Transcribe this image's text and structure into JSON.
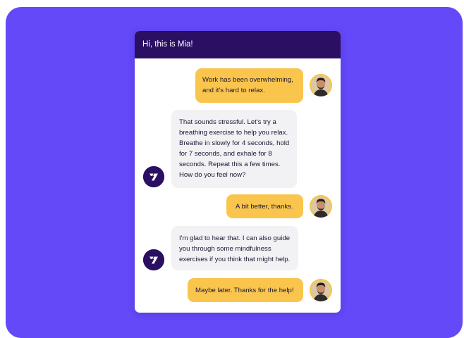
{
  "header": {
    "title": "Hi, this is Mia!"
  },
  "messages": [
    {
      "sender": "user",
      "lines": [
        "Work has been overwhelming,",
        "and it's hard to relax."
      ]
    },
    {
      "sender": "bot",
      "lines": [
        "That sounds stressful. Let's try a",
        "breathing exercise to help you relax.",
        "Breathe in slowly for 4 seconds, hold",
        "for 7 seconds, and exhale for 8",
        "seconds. Repeat this a few times.",
        "How do you feel now?"
      ]
    },
    {
      "sender": "user",
      "lines": [
        "A bit better, thanks."
      ]
    },
    {
      "sender": "bot",
      "lines": [
        "I'm glad to hear that. I can also guide",
        "you through some mindfulness",
        "exercises if you think that might help."
      ]
    },
    {
      "sender": "user",
      "lines": [
        "Maybe later. Thanks for the help!"
      ]
    }
  ],
  "colors": {
    "background": "#6349f7",
    "header": "#2b0f63",
    "user_bubble": "#fac54d",
    "bot_bubble": "#f2f1f4"
  },
  "icons": {
    "user_avatar": "user-avatar-photo",
    "bot_avatar": "brand-logo-icon"
  }
}
